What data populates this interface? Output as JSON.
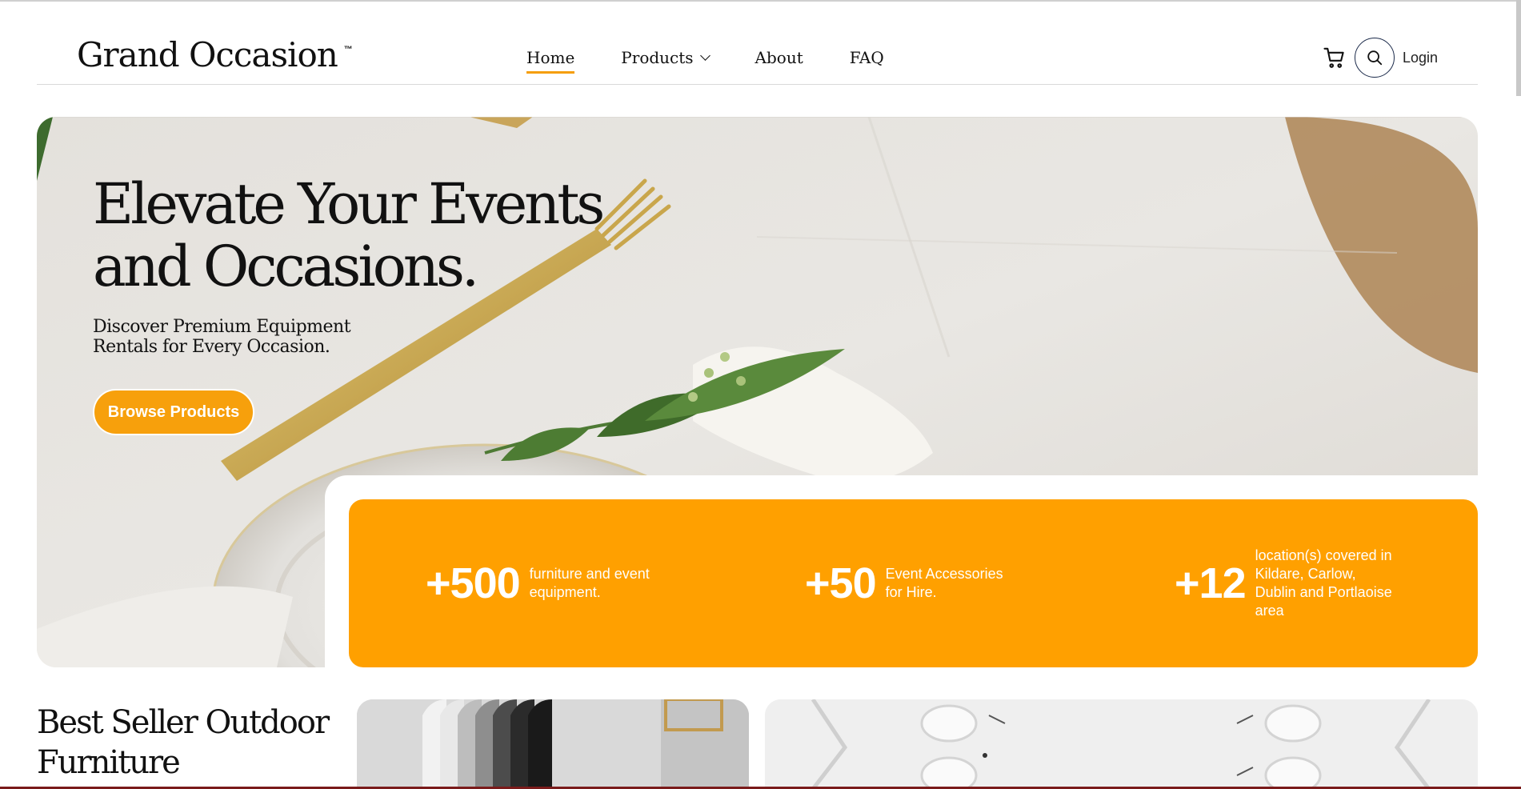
{
  "header": {
    "logo": "Grand Occasion",
    "logo_tm": "™",
    "nav": [
      {
        "label": "Home",
        "active": true
      },
      {
        "label": "Products",
        "has_dropdown": true
      },
      {
        "label": "About"
      },
      {
        "label": "FAQ"
      }
    ],
    "login_label": "Login",
    "icons": [
      "cart-icon",
      "search-icon"
    ]
  },
  "hero": {
    "title_line1": "Elevate Your Events",
    "title_line2": "and Occasions.",
    "subtitle_line1": "Discover Premium Equipment",
    "subtitle_line2": "Rentals for Every Occasion.",
    "button_label": "Browse Products"
  },
  "stats": [
    {
      "number": "+500",
      "text": "furniture and event equipment."
    },
    {
      "number": "+50",
      "text": "Event Accessories for Hire."
    },
    {
      "number": "+12",
      "text": "location(s) covered in Kildare, Carlow, Dublin and Portlaoise area"
    }
  ],
  "best_seller": {
    "title_line1": "Best Seller Outdoor",
    "title_line2": "Furniture"
  },
  "colors": {
    "accent": "#FFA000",
    "text": "#111111"
  }
}
